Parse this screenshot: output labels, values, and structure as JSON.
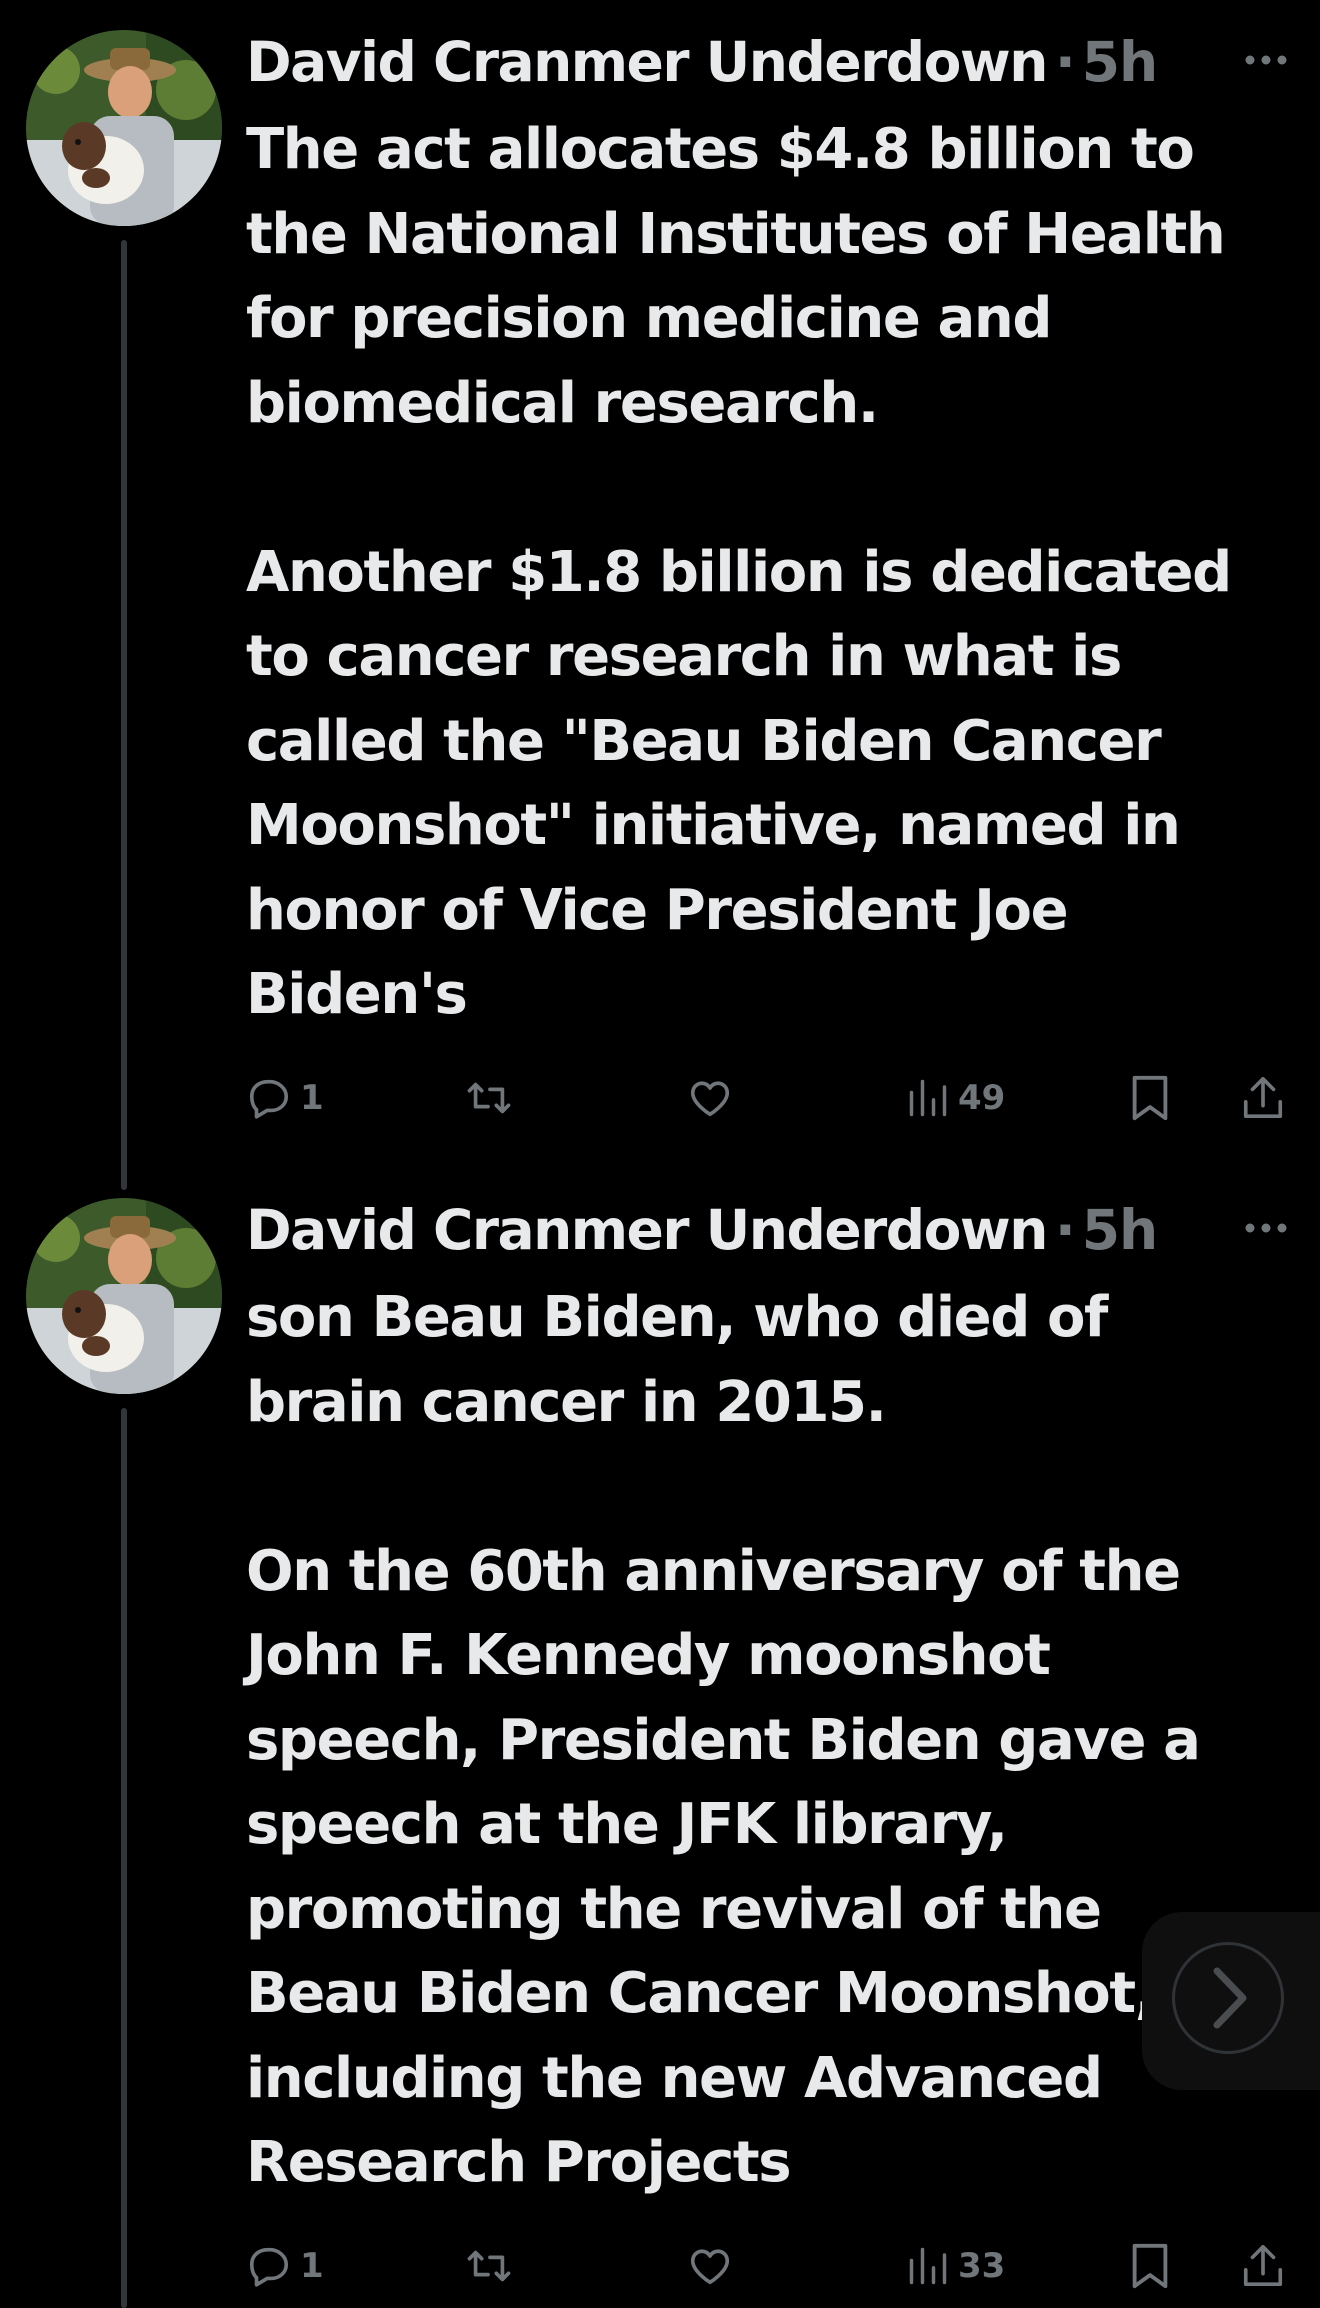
{
  "thread": [
    {
      "author": "David Cranmer Underdown",
      "separator": "·",
      "time": "5h",
      "paragraphs": [
        "The act allocates $4.8 billion to the National Institutes of Health for precision medicine and biomedical research.",
        "Another $1.8 billion is dedicated to cancer research in what is called the \"Beau Biden Cancer Moonshot\" initiative, named in honor of Vice President Joe Biden's"
      ],
      "actions": {
        "replies": "1",
        "reposts": "",
        "likes": "",
        "views": "49"
      }
    },
    {
      "author": "David Cranmer Underdown",
      "separator": "·",
      "time": "5h",
      "paragraphs": [
        "son Beau Biden, who died of brain cancer in 2015.",
        "On the 60th anniversary of the John F. Kennedy moonshot speech, President Biden gave a speech at the JFK library, promoting the revival of the Beau Biden Cancer Moonshot, including the new Advanced Research Projects"
      ],
      "actions": {
        "replies": "1",
        "reposts": "",
        "likes": "",
        "views": "33"
      }
    }
  ],
  "icons": {
    "more": "more-horizontal-icon",
    "reply": "reply-bubble-icon",
    "repost": "repost-arrows-icon",
    "like": "heart-icon",
    "views": "analytics-bars-icon",
    "bookmark": "bookmark-icon",
    "share": "share-upload-icon",
    "next": "chevron-right-icon"
  },
  "colors": {
    "background": "#000000",
    "text": "#e7e9ea",
    "muted": "#71767b",
    "thread_line": "#333639"
  }
}
